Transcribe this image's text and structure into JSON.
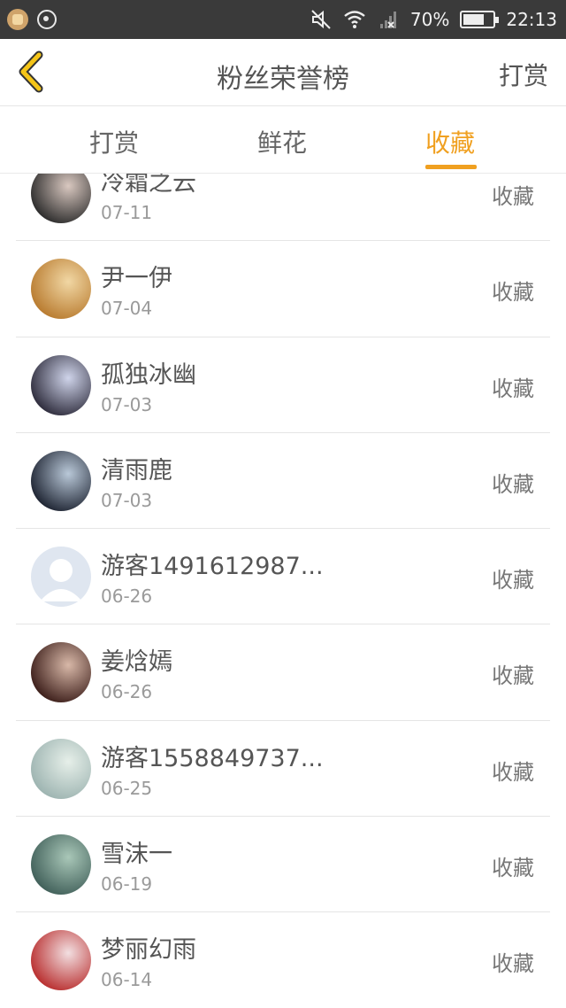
{
  "status_bar": {
    "battery": "70%",
    "battery_fraction": 0.7,
    "time": "22:13"
  },
  "header": {
    "title": "粉丝荣誉榜",
    "right_action": "打赏"
  },
  "tabs": [
    {
      "label": "打赏",
      "active": false
    },
    {
      "label": "鲜花",
      "active": false
    },
    {
      "label": "收藏",
      "active": true
    }
  ],
  "accent_color": "#f0a020",
  "list": [
    {
      "name": "冷霜之云",
      "date": "07-11",
      "action": "收藏",
      "avatar": [
        "#2a2a2a",
        "#d9c8c0"
      ]
    },
    {
      "name": "尹一伊",
      "date": "07-04",
      "action": "收藏",
      "avatar": [
        "#b87a2e",
        "#f1d7a4"
      ]
    },
    {
      "name": "孤独冰幽",
      "date": "07-03",
      "action": "收藏",
      "avatar": [
        "#2c2a3a",
        "#cfd4ea"
      ]
    },
    {
      "name": "清雨鹿",
      "date": "07-03",
      "action": "收藏",
      "avatar": [
        "#1c2230",
        "#b9c8d8"
      ]
    },
    {
      "name": "游客1491612987...",
      "date": "06-26",
      "action": "收藏",
      "avatar": [
        "#dfe6f0",
        "#ffffff"
      ],
      "placeholder": true
    },
    {
      "name": "姜焓嫣",
      "date": "06-26",
      "action": "收藏",
      "avatar": [
        "#3a1c18",
        "#d8b8a8"
      ]
    },
    {
      "name": "游客1558849737...",
      "date": "06-25",
      "action": "收藏",
      "avatar": [
        "#9cb3b0",
        "#e6efe9"
      ]
    },
    {
      "name": "雪沫一",
      "date": "06-19",
      "action": "收藏",
      "avatar": [
        "#3f5e58",
        "#a9c7b8"
      ]
    },
    {
      "name": "梦丽幻雨",
      "date": "06-14",
      "action": "收藏",
      "avatar": [
        "#b82c2c",
        "#f2dfe1"
      ]
    }
  ]
}
